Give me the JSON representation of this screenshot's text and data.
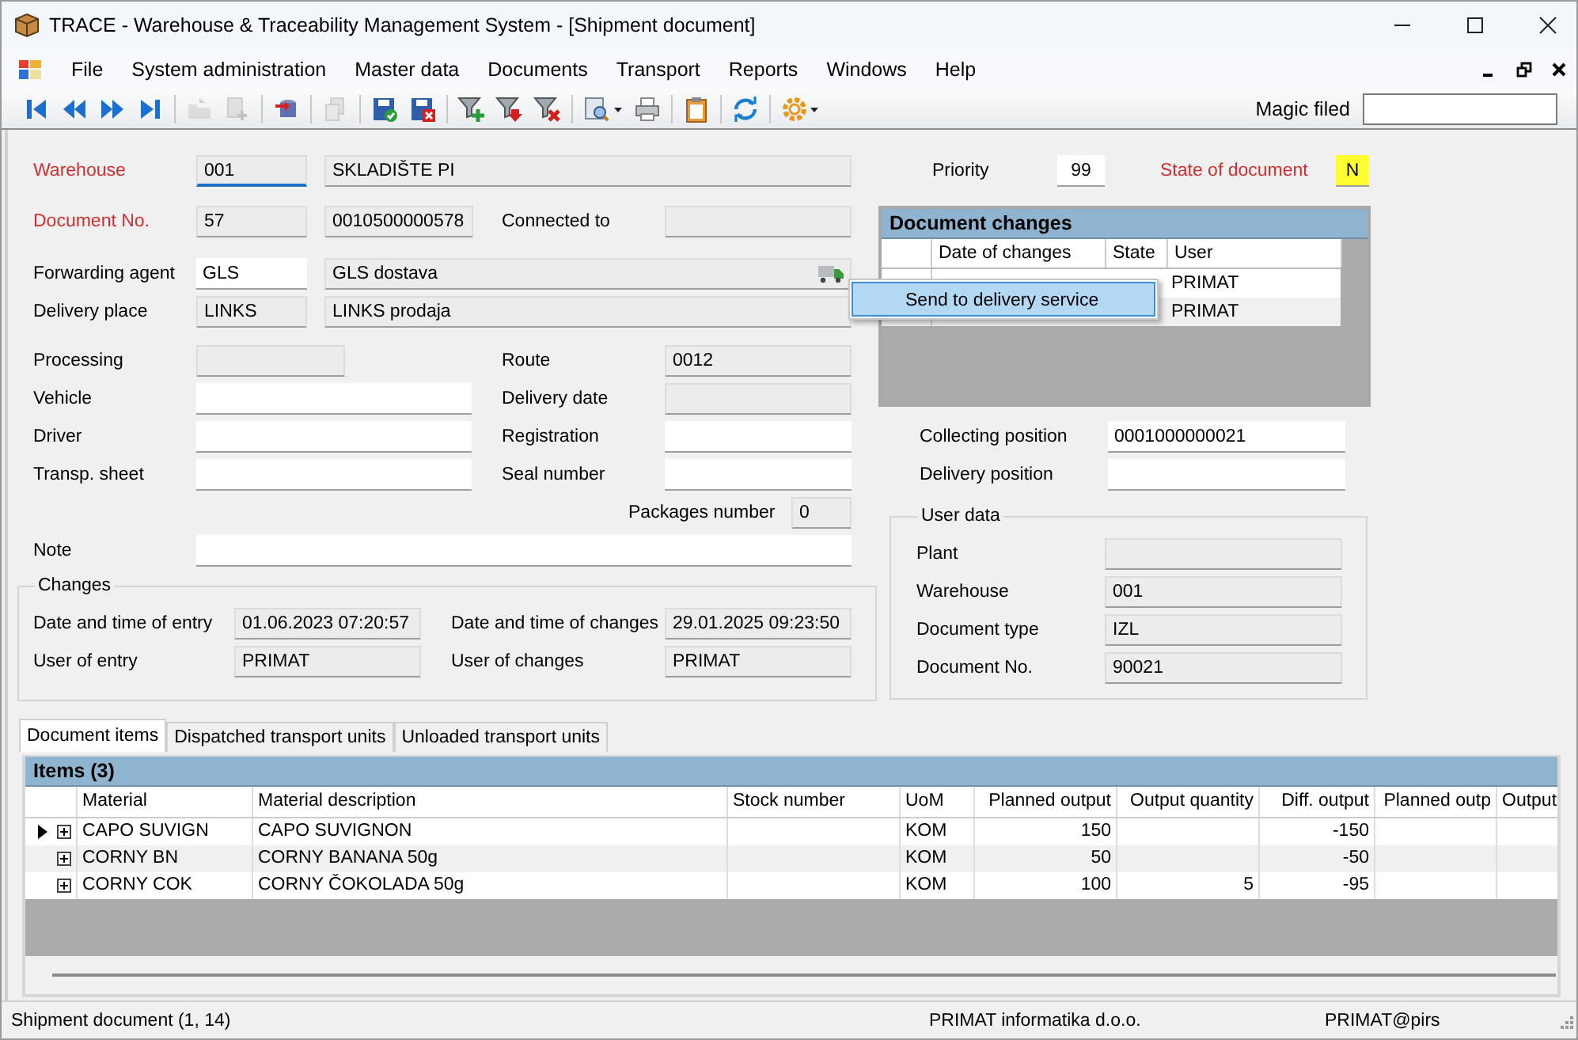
{
  "window": {
    "title": "TRACE - Warehouse & Traceability Management System - [Shipment document]"
  },
  "menu": [
    "File",
    "System administration",
    "Master data",
    "Documents",
    "Transport",
    "Reports",
    "Windows",
    "Help"
  ],
  "toolbar": [
    {
      "kind": "first",
      "disabled": false
    },
    {
      "kind": "previous",
      "disabled": false
    },
    {
      "kind": "next",
      "disabled": false
    },
    {
      "kind": "last",
      "disabled": false
    },
    {
      "kind": "separator"
    },
    {
      "kind": "open",
      "disabled": true
    },
    {
      "kind": "add",
      "disabled": true
    },
    {
      "kind": "separator"
    },
    {
      "kind": "import",
      "disabled": false
    },
    {
      "kind": "separator"
    },
    {
      "kind": "copy",
      "disabled": true
    },
    {
      "kind": "separator"
    },
    {
      "kind": "save",
      "disabled": false
    },
    {
      "kind": "discard",
      "disabled": false
    },
    {
      "kind": "separator"
    },
    {
      "kind": "filter_add",
      "disabled": false
    },
    {
      "kind": "filter_down",
      "disabled": false
    },
    {
      "kind": "filter_remove",
      "disabled": false
    },
    {
      "kind": "separator"
    },
    {
      "kind": "preview",
      "disabled": false
    },
    {
      "kind": "print",
      "disabled": false
    },
    {
      "kind": "separator"
    },
    {
      "kind": "clipboard",
      "disabled": false
    },
    {
      "kind": "separator"
    },
    {
      "kind": "refresh",
      "disabled": false
    },
    {
      "kind": "separator"
    },
    {
      "kind": "settings",
      "disabled": false
    }
  ],
  "magic_field": {
    "label": "Magic filed"
  },
  "form": {
    "warehouse": {
      "label": "Warehouse",
      "required": true,
      "fields": [
        {
          "value": "001",
          "disabled": true,
          "focused": true
        },
        {
          "value": "SKLADIŠTE PI",
          "disabled": true
        }
      ]
    },
    "document_no": {
      "label": "Document No.",
      "required": true,
      "fields": [
        {
          "value": "57",
          "disabled": true
        },
        {
          "value": "0010500000578",
          "disabled": true
        }
      ]
    },
    "connected_to": {
      "label": "Connected to",
      "required": false,
      "fields": [
        {
          "disabled": true
        }
      ]
    },
    "forwarding_agent": {
      "label": "Forwarding agent",
      "required": false,
      "fields": [
        {
          "value": "GLS",
          "disabled": false
        },
        {
          "value": "GLS dostava",
          "disabled": true,
          "kind": "lookup"
        }
      ]
    },
    "delivery_place": {
      "label": "Delivery place",
      "required": false,
      "fields": [
        {
          "value": "LINKS",
          "disabled": true
        },
        {
          "value": "LINKS prodaja",
          "disabled": true
        }
      ]
    },
    "processing": {
      "label": "Processing",
      "required": false,
      "fields": [
        {
          "disabled": true
        }
      ]
    },
    "route": {
      "label": "Route",
      "required": false,
      "fields": [
        {
          "value": "0012",
          "disabled": true
        }
      ]
    },
    "vehicle": {
      "label": "Vehicle",
      "required": false,
      "fields": [
        {
          "disabled": false
        }
      ]
    },
    "delivery_date": {
      "label": "Delivery date",
      "required": false,
      "fields": [
        {
          "disabled": true
        }
      ]
    },
    "driver": {
      "label": "Driver",
      "required": false,
      "fields": [
        {
          "disabled": false
        }
      ]
    },
    "registration": {
      "label": "Registration",
      "required": false,
      "fields": [
        {
          "disabled": false
        }
      ]
    },
    "transp_sheet": {
      "label": "Transp. sheet",
      "required": false,
      "fields": [
        {
          "disabled": false
        }
      ]
    },
    "seal_number": {
      "label": "Seal number",
      "required": false,
      "fields": [
        {
          "disabled": false
        }
      ]
    },
    "packages_number": {
      "label": "Packages number",
      "required": false,
      "fields": [
        {
          "value": "0",
          "disabled": true
        }
      ]
    },
    "note": {
      "label": "Note",
      "required": false,
      "fields": [
        {
          "disabled": false
        }
      ]
    },
    "priority": {
      "label": "Priority",
      "required": false,
      "fields": [
        {
          "value": "99",
          "disabled": false,
          "highlight": false
        }
      ]
    },
    "state_of_document": {
      "label": "State of document",
      "required": true,
      "fields": [
        {
          "value": "N",
          "disabled": false,
          "highlight": true
        }
      ]
    },
    "collecting_position": {
      "label": "Collecting position",
      "required": false,
      "fields": [
        {
          "value": "0001000000021",
          "disabled": false
        }
      ]
    },
    "delivery_position": {
      "label": "Delivery position",
      "required": false,
      "fields": [
        {
          "disabled": false
        }
      ]
    }
  },
  "changes": {
    "title": "Changes",
    "date_of_entry": {
      "label": "Date and time of entry",
      "fields": [
        {
          "value": "01.06.2023 07:20:57",
          "disabled": true
        }
      ]
    },
    "date_of_changes": {
      "label": "Date and time of changes",
      "fields": [
        {
          "value": "29.01.2025 09:23:50",
          "disabled": true
        }
      ]
    },
    "user_of_entry": {
      "label": "User of entry",
      "fields": [
        {
          "value": "PRIMAT",
          "disabled": true
        }
      ]
    },
    "user_of_changes": {
      "label": "User of changes",
      "fields": [
        {
          "value": "PRIMAT",
          "disabled": true
        }
      ]
    }
  },
  "user_data": {
    "title": "User data",
    "plant": {
      "label": "Plant",
      "fields": [
        {
          "disabled": true
        }
      ]
    },
    "warehouse": {
      "label": "Warehouse",
      "fields": [
        {
          "value": "001",
          "disabled": true
        }
      ]
    },
    "document_type": {
      "label": "Document type",
      "fields": [
        {
          "value": "IZL",
          "disabled": true
        }
      ]
    },
    "document_no": {
      "label": "Document No.",
      "fields": [
        {
          "value": "90021",
          "disabled": true
        }
      ]
    }
  },
  "document_changes": {
    "title": "Document changes",
    "columns": [
      "Date of changes",
      "State",
      "User"
    ],
    "rows": [
      {
        "user": "PRIMAT"
      },
      {
        "user": "PRIMAT"
      }
    ]
  },
  "context_menu": [
    {
      "label": "Send to delivery service",
      "selected": true
    }
  ],
  "tabs": [
    {
      "label": "Document items",
      "selected": true
    },
    {
      "label": "Dispatched transport units",
      "selected": false
    },
    {
      "label": "Unloaded transport units",
      "selected": false
    }
  ],
  "items": {
    "title": "Items (3)",
    "columns": [
      "Material",
      "Material description",
      "Stock number",
      "UoM",
      "Planned output",
      "Output quantity",
      "Diff. output",
      "Planned outp",
      "Output"
    ],
    "rows": [
      {
        "current": true,
        "cells": [
          "CAPO SUVIGN",
          "CAPO SUVIGNON",
          null,
          "KOM",
          "150",
          null,
          "-150",
          null,
          null
        ]
      },
      {
        "current": false,
        "cells": [
          "CORNY BN",
          "CORNY BANANA 50g",
          null,
          "KOM",
          "50",
          null,
          "-50",
          null,
          null
        ]
      },
      {
        "current": false,
        "cells": [
          "CORNY COK",
          "CORNY ČOKOLADA 50g",
          null,
          "KOM",
          "100",
          "5",
          "-95",
          null,
          null
        ]
      }
    ]
  },
  "status_bar": {
    "left": "Shipment document (1, 14)",
    "company": "PRIMAT informatika d.o.o.",
    "user": "PRIMAT@pirs"
  }
}
